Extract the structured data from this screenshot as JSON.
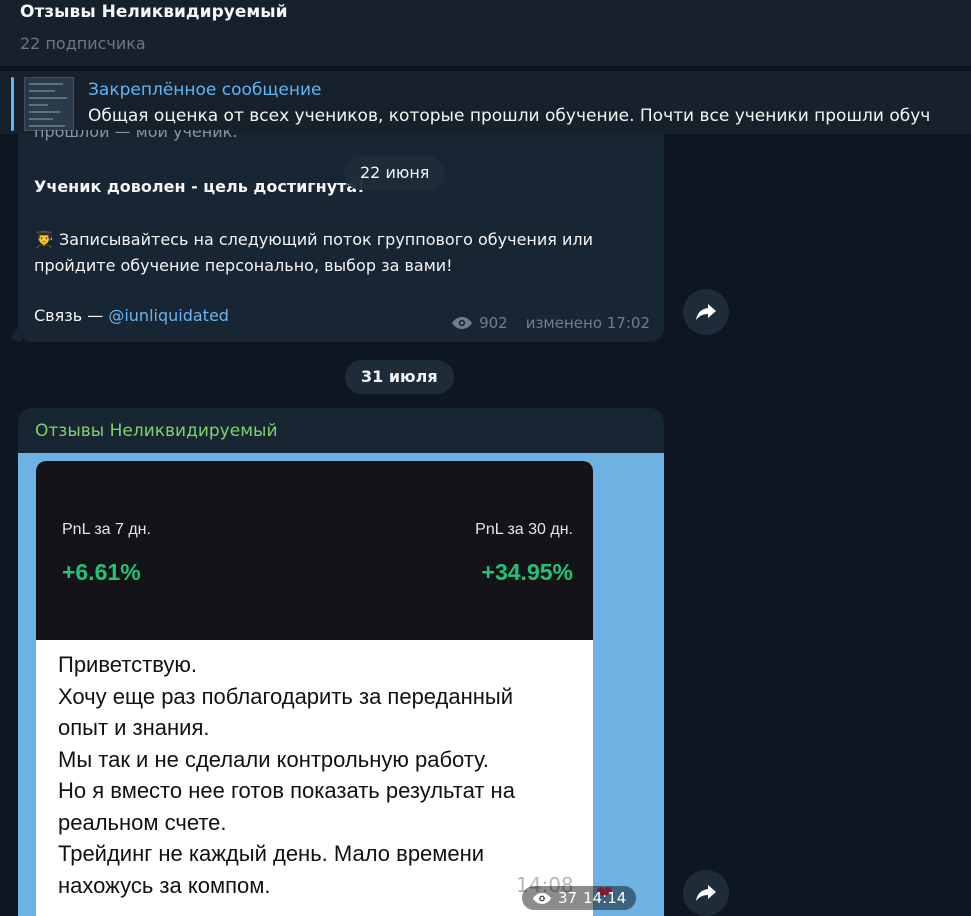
{
  "header": {
    "title": "Отзывы Неликвидируемый",
    "subtitle": "22 подписчика"
  },
  "pinned": {
    "title": "Закреплённое сообщение",
    "text": "Общая оценка от всех учеников, которые прошли обучение. Почти все ученики прошли обуч"
  },
  "post1": {
    "cut_text": "прошлой — мой ученик.",
    "floating_date": "22 июня",
    "headline": "Ученик доволен - цель достигнута!",
    "emoji": "👨‍🎓",
    "body": "Записывайтесь на следующий поток группового обучения или пройдите обучение персонально, выбор за вами!",
    "contact_label": "Связь — ",
    "contact_link": "@iunliquidated",
    "views": "902",
    "edited": "изменено 17:02"
  },
  "date_separator": "31 июля",
  "post2": {
    "author": "Отзывы Неликвидируемый",
    "image": {
      "pnl7_label": "PnL за 7 дн.",
      "pnl7_value": "+6.61%",
      "pnl30_label": "PnL за 30 дн.",
      "pnl30_value": "+34.95%",
      "message_lines": [
        "Приветствую.",
        "Хочу еще раз поблагодарить за переданный",
        "опыт и знания.",
        "Мы так и не сделали контрольную работу.",
        "Но я вместо нее готов показать результат на",
        "реальном счете.",
        "Трейдинг не каждый день. Мало времени",
        "нахожусь за компом."
      ],
      "inner_time": "14:08"
    },
    "views": "37",
    "time": "14:14"
  },
  "icons": {
    "share": "share-icon",
    "eye": "eye-icon",
    "heart": "heart-icon"
  },
  "colors": {
    "background": "#0e1621",
    "bubble": "#182533",
    "link": "#6ab3f3",
    "author": "#7dd36a",
    "profit": "#21c27a"
  }
}
